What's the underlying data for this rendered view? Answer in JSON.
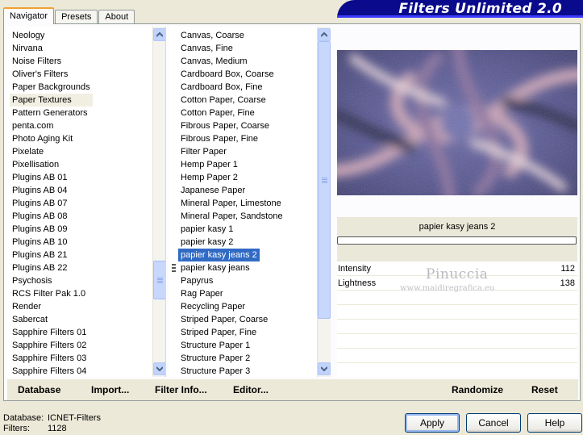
{
  "tabs": [
    {
      "label": "Navigator",
      "active": true
    },
    {
      "label": "Presets",
      "active": false
    },
    {
      "label": "About",
      "active": false
    }
  ],
  "banner_title": "Filters Unlimited 2.0",
  "categories": {
    "items": [
      "Neology",
      "Nirvana",
      "Noise Filters",
      "Oliver's Filters",
      "Paper Backgrounds",
      "Paper Textures",
      "Pattern Generators",
      "penta.com",
      "Photo Aging Kit",
      "Pixelate",
      "Pixellisation",
      "Plugins AB 01",
      "Plugins AB 04",
      "Plugins AB 07",
      "Plugins AB 08",
      "Plugins AB 09",
      "Plugins AB 10",
      "Plugins AB 21",
      "Plugins AB 22",
      "Psychosis",
      "RCS Filter Pak 1.0",
      "Render",
      "Sabercat",
      "Sapphire Filters 01",
      "Sapphire Filters 02",
      "Sapphire Filters 03",
      "Sapphire Filters 04"
    ],
    "selected": "Paper Textures"
  },
  "filters": {
    "items": [
      "Canvas, Coarse",
      "Canvas, Fine",
      "Canvas, Medium",
      "Cardboard Box, Coarse",
      "Cardboard Box, Fine",
      "Cotton Paper, Coarse",
      "Cotton Paper, Fine",
      "Fibrous Paper, Coarse",
      "Fibrous Paper, Fine",
      "Filter Paper",
      "Hemp Paper 1",
      "Hemp Paper 2",
      "Japanese Paper",
      "Mineral Paper, Limestone",
      "Mineral Paper, Sandstone",
      "papier kasy 1",
      "papier kasy 2",
      "papier kasy jeans 2",
      "papier kasy jeans",
      "Papyrus",
      "Rag Paper",
      "Recycling Paper",
      "Striped Paper, Coarse",
      "Striped Paper, Fine",
      "Structure Paper 1",
      "Structure Paper 2",
      "Structure Paper 3"
    ],
    "selected": "papier kasy jeans 2",
    "marked": "papier kasy jeans"
  },
  "filter_name": "papier kasy jeans 2",
  "params": [
    {
      "name": "Intensity",
      "value": "112"
    },
    {
      "name": "Lightness",
      "value": "138"
    }
  ],
  "watermark": {
    "line1": "Pinuccia",
    "line2": "www.maidiregrafica.eu"
  },
  "actions": {
    "database": "Database",
    "import": "Import...",
    "filter_info": "Filter Info...",
    "editor": "Editor...",
    "randomize": "Randomize",
    "reset": "Reset"
  },
  "footer": {
    "database_label": "Database:",
    "database_value": "ICNET-Filters",
    "filters_label": "Filters:",
    "filters_value": "1128"
  },
  "buttons": {
    "apply": "Apply",
    "cancel": "Cancel",
    "help": "Help"
  },
  "colors": {
    "banner": "#0a0a8c",
    "selection": "#316ac5",
    "tab_accent": "#f0a030"
  }
}
